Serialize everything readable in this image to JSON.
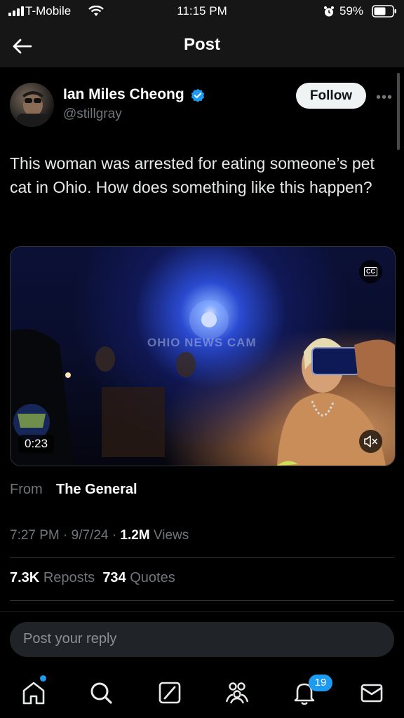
{
  "status_bar": {
    "carrier": "T-Mobile",
    "time": "11:15 PM",
    "battery": "59%"
  },
  "header": {
    "title": "Post"
  },
  "tweet": {
    "author_name": "Ian Miles Cheong",
    "handle": "@stillgray",
    "follow_label": "Follow",
    "text": "This woman was arrested for eating someone’s pet cat in Ohio. How does something like this happen?",
    "video": {
      "duration": "0:23",
      "watermark": "OHIO NEWS CAM",
      "cc_label": "CC"
    },
    "from_label": "From",
    "from_name": "The General",
    "time": "7:27 PM",
    "date": "9/7/24",
    "views_count": "1.2M",
    "views_label": "Views",
    "reposts_count": "7.3K",
    "reposts_label": "Reposts",
    "quotes_count": "734",
    "quotes_label": "Quotes"
  },
  "reply": {
    "placeholder": "Post your reply"
  },
  "tabbar": {
    "notifications_badge": "19"
  },
  "colors": {
    "accent": "#1d9bf0",
    "background": "#000000",
    "muted": "#71767b"
  }
}
